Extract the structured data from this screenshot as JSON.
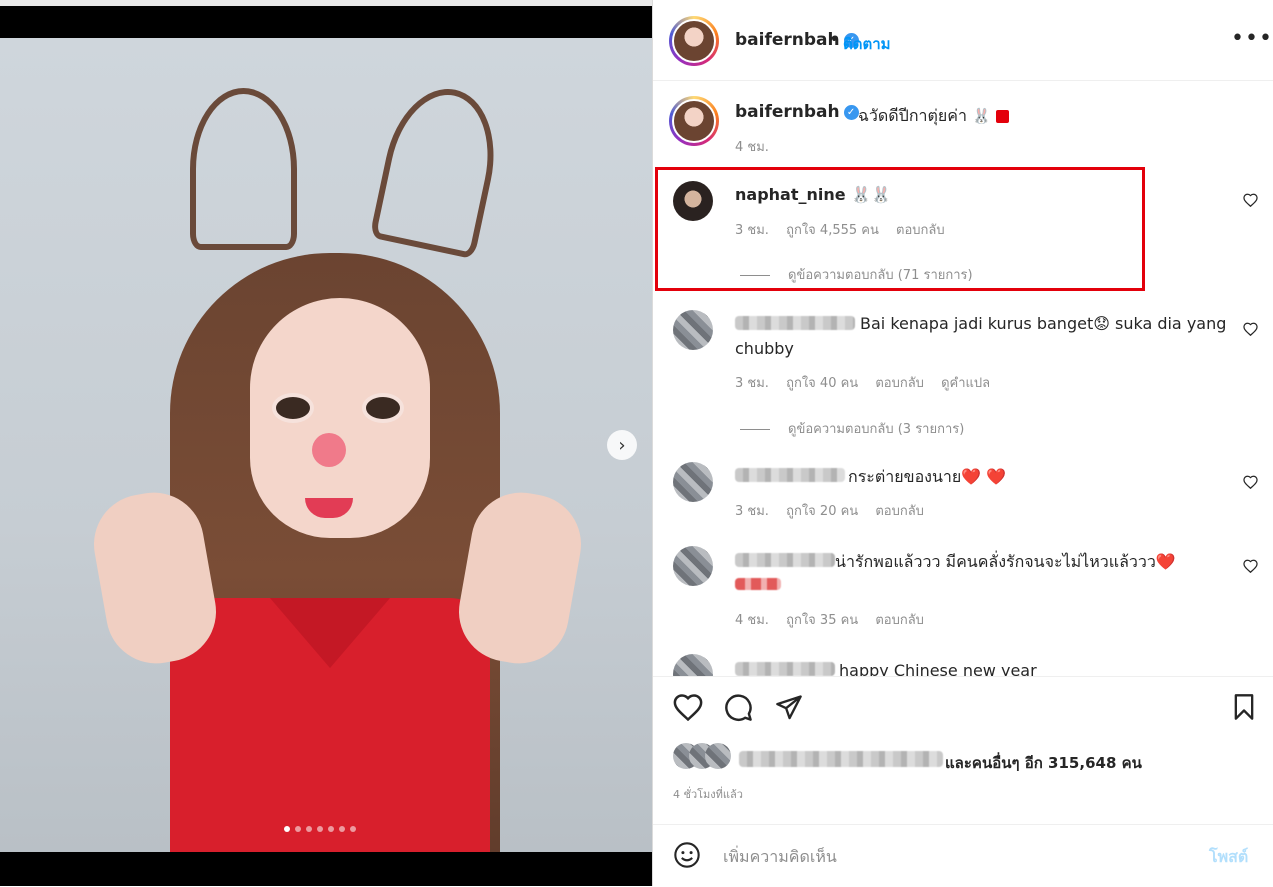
{
  "media": {
    "slide_count": 7,
    "active_slide": 1,
    "next_icon": "chevron-right-icon",
    "next_glyph": "›"
  },
  "header": {
    "username": "baifernbah",
    "follow_label": "ติดตาม",
    "separator": "•",
    "more_glyph": "•••"
  },
  "caption": {
    "username": "baifernbah",
    "text": "ฉวัดดีปีกาตุ่ยค่า",
    "emoji": "🐰",
    "time": "4 ชม."
  },
  "comments": [
    {
      "username": "naphat_nine",
      "text": "🐰🐰",
      "time": "3 ชม.",
      "likes": "ถูกใจ 4,555 คน",
      "reply": "ตอบกลับ",
      "view_replies": "ดูข้อความตอบกลับ (71 รายการ)",
      "highlighted": true
    },
    {
      "username": "",
      "text": "Bai kenapa jadi kurus banget😟 suka dia yang",
      "text_line2": "chubby",
      "time": "3 ชม.",
      "likes": "ถูกใจ 40 คน",
      "reply": "ตอบกลับ",
      "translate": "ดูคำแปล",
      "view_replies": "ดูข้อความตอบกลับ (3 รายการ)"
    },
    {
      "username": "",
      "text": "กระต่ายของนาย❤️ ❤️",
      "time": "3 ชม.",
      "likes": "ถูกใจ 20 คน",
      "reply": "ตอบกลับ"
    },
    {
      "username": "",
      "text": "น่ารักพอแล้ววว มีคนคลั่งรักจนจะไม่ไหวแล้ววว❤️",
      "time": "4 ชม.",
      "likes": "ถูกใจ 35 คน",
      "reply": "ตอบกลับ"
    },
    {
      "username": "",
      "text": "happy Chinese new year"
    }
  ],
  "actions": {
    "like_icon": "heart-icon",
    "comment_icon": "comment-icon",
    "share_icon": "send-icon",
    "save_icon": "bookmark-icon",
    "likes_text": "และคนอื่นๆ อีก 315,648 คน",
    "time_ago": "4 ชั่วโมงที่แล้ว"
  },
  "add_comment": {
    "placeholder": "เพิ่มความคิดเห็น",
    "post_label": "โพสต์",
    "emoji_icon": "smiley-icon"
  },
  "colors": {
    "accent": "#0095f6",
    "highlight_border": "#e3000b",
    "post_disabled": "#b2dffc",
    "verified": "#3897f0"
  }
}
